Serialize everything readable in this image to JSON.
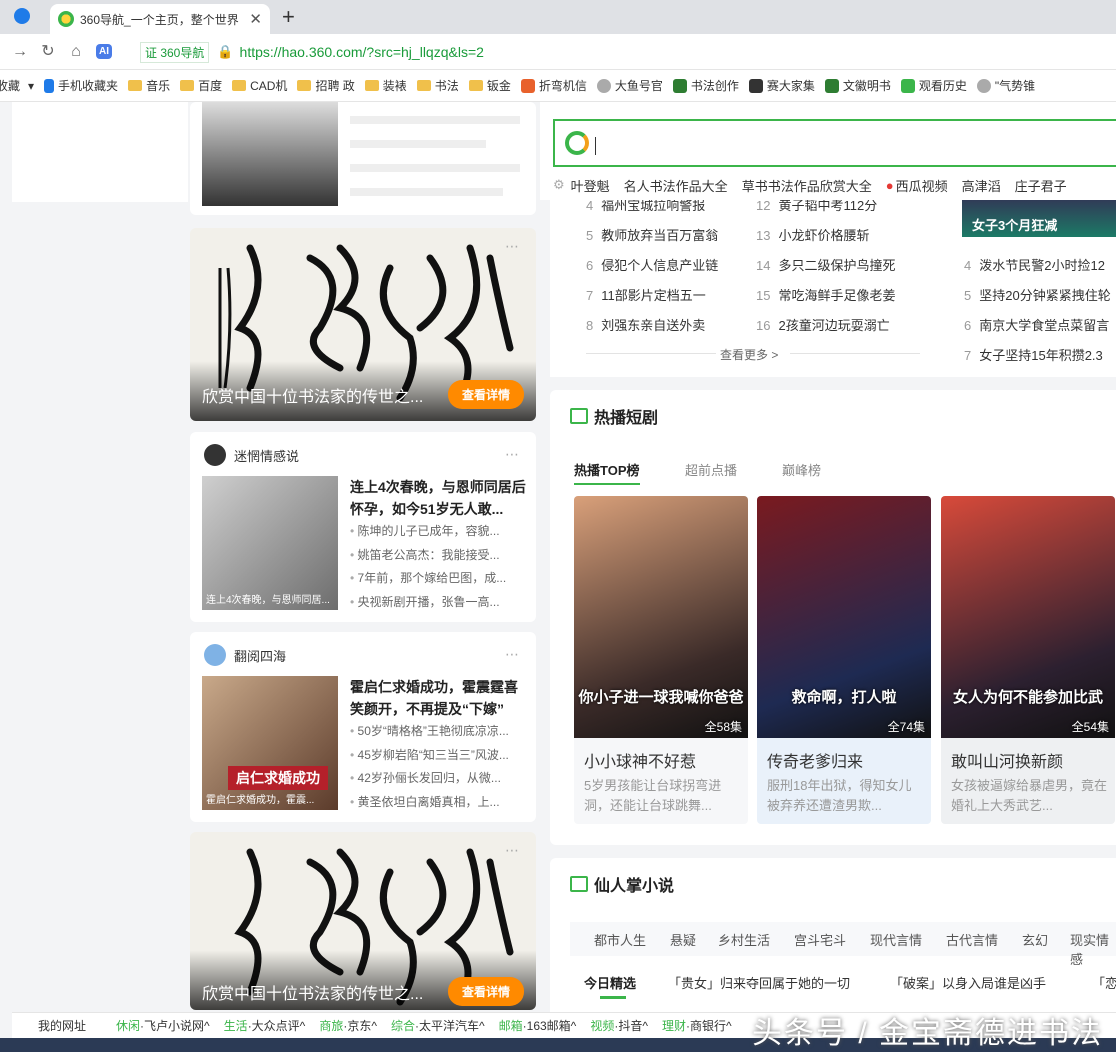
{
  "browser": {
    "tab_title": "360导航_一个主页，整个世界",
    "tab_close": "✕",
    "new_tab": "+",
    "cert_label": "证 360导航",
    "url": "https://hao.360.com/?src=hj_llqzq&ls=2",
    "extension_label": "AI",
    "bookmarks": [
      "收藏",
      "手机收藏夹",
      "音乐",
      "百度",
      "CAD机",
      "招聘 政",
      "装裱",
      "书法",
      "钣金",
      "折弯机信",
      "大鱼号官",
      "书法创作",
      "赛大家集",
      "文徽明书",
      "观看历史",
      "\"气势锥"
    ]
  },
  "search": {
    "suggestions": [
      "叶登魁",
      "名人书法作品大全",
      "草书书法作品欣赏大全",
      "西瓜视频",
      "高津滔",
      "庄子君子"
    ]
  },
  "feed": {
    "calligraphy_cards": [
      {
        "title": "欣赏中国十位书法家的传世之...",
        "button": "查看详情"
      },
      {
        "title": "欣赏中国十位书法家的传世之...",
        "button": "查看详情"
      }
    ],
    "news_cards": [
      {
        "source": "迷惘情感说",
        "headline": "连上4次春晚，与恩师同居后怀孕，如今51岁无人敢...",
        "thumb_caption": "连上4次春晚，与恩师同居...",
        "bullets": [
          "陈坤的儿子已成年，容貌...",
          "姚笛老公高杰：我能接受...",
          "7年前，那个嫁给巴图，成...",
          "央视新剧开播，张鲁一高..."
        ]
      },
      {
        "source": "翻阅四海",
        "headline": "霍启仁求婚成功，霍震霆喜笑颜开，不再提及“下嫁”",
        "thumb_caption": "霍启仁求婚成功，霍震...",
        "thumb_banner": "启仁求婚成功",
        "bullets": [
          "50岁“晴格格”王艳彻底凉凉...",
          "45岁柳岩陷“知三当三”风波...",
          "42岁孙俪长发回归，从微...",
          "黄圣依坦白离婚真相，上..."
        ]
      }
    ]
  },
  "hotlist": {
    "left": [
      {
        "n": "4",
        "t": "福州宝城拉响警报"
      },
      {
        "n": "5",
        "t": "教师放弃当百万富翁"
      },
      {
        "n": "6",
        "t": "侵犯个人信息产业链"
      },
      {
        "n": "7",
        "t": "11部影片定档五一"
      },
      {
        "n": "8",
        "t": "刘强东亲自送外卖"
      }
    ],
    "mid": [
      {
        "n": "12",
        "t": "黄子韬中考112分"
      },
      {
        "n": "13",
        "t": "小龙虾价格腰斩"
      },
      {
        "n": "14",
        "t": "多只二级保护鸟撞死"
      },
      {
        "n": "15",
        "t": "常吃海鲜手足像老姜"
      },
      {
        "n": "16",
        "t": "2孩童河边玩耍溺亡"
      }
    ],
    "right": [
      {
        "n": "4",
        "t": "泼水节民警2小时捡12"
      },
      {
        "n": "5",
        "t": "坚持20分钟紧紧拽住轮"
      },
      {
        "n": "6",
        "t": "南京大学食堂点菜留言"
      },
      {
        "n": "7",
        "t": "女子坚持15年积攒2.3"
      }
    ],
    "more": "查看更多 >",
    "promo": "女子3个月狂减"
  },
  "dramas": {
    "title": "热播短剧",
    "tabs": [
      "热播TOP榜",
      "超前点播",
      "巅峰榜"
    ],
    "items": [
      {
        "caption": "你小子进一球我喊你爸爸",
        "count": "全58集",
        "title": "小小球神不好惹",
        "desc": "5岁男孩能让台球拐弯进洞，还能让台球跳舞..."
      },
      {
        "caption": "救命啊，打人啦",
        "count": "全74集",
        "title": "传奇老爹归来",
        "desc": "服刑18年出狱，得知女儿被弃养还遭渣男欺..."
      },
      {
        "caption": "女人为何不能参加比武",
        "count": "全54集",
        "title": "敢叫山河换新颜",
        "desc": "女孩被逼嫁给暴虐男，竟在婚礼上大秀武艺..."
      }
    ]
  },
  "novels": {
    "title": "仙人掌小说",
    "categories": [
      "都市人生",
      "悬疑",
      "乡村生活",
      "宫斗宅斗",
      "现代言情",
      "古代言情",
      "玄幻",
      "现实情感"
    ],
    "today_label": "今日精选",
    "picks": [
      "「贵女」归来夺回属于她的一切",
      "「破案」以身入局谁是凶手",
      "「恋"
    ]
  },
  "bottom_bar": {
    "my_sites": "我的网址",
    "items": [
      {
        "k": "休闲",
        "v": "·飞卢小说网^"
      },
      {
        "k": "生活",
        "v": "·大众点评^"
      },
      {
        "k": "商旅",
        "v": "·京东^"
      },
      {
        "k": "综合",
        "v": "·太平洋汽车^"
      },
      {
        "k": "邮箱",
        "v": "·163邮箱^"
      },
      {
        "k": "视频",
        "v": "·抖音^"
      },
      {
        "k": "理财",
        "v": "·商银行^"
      }
    ]
  },
  "watermark": "头条号 / 金宝斋德进书法",
  "colors": {
    "accent": "#3bb54a",
    "orange": "#ff8a00",
    "link": "#1a9b3a"
  }
}
